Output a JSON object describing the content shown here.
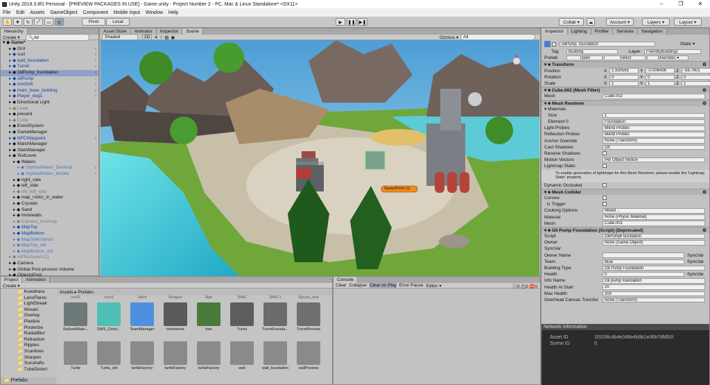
{
  "window": {
    "title": "Unity 2018.3.8f1 Personal - [PREVIEW PACKAGES IN USE] - Game.unity - Project Number 2 - PC, Mac & Linux Standalone* <DX11>",
    "min": "–",
    "max": "❐",
    "close": "✕"
  },
  "menu": [
    "File",
    "Edit",
    "Assets",
    "GameObject",
    "Component",
    "Mobile Input",
    "Window",
    "Help"
  ],
  "toolbar": {
    "pivot": "Pivot",
    "local": "Local",
    "collab": "Collab ▾",
    "account": "Account ▾",
    "layers": "Layers ▾",
    "layout": "Layout ▾"
  },
  "hierarchy": {
    "tab": "Hierarchy",
    "create": "Create ▾",
    "search": "All",
    "scene": "Game*",
    "rows": [
      {
        "t": "GUI",
        "i": 1,
        "c": "n",
        "a": 1
      },
      {
        "t": "wall",
        "i": 1,
        "c": "b",
        "a": 1
      },
      {
        "t": "wall_foundation",
        "i": 1,
        "c": "b",
        "a": 1
      },
      {
        "t": "Turret",
        "i": 1,
        "c": "b",
        "a": 1
      },
      {
        "t": "OilPump_foundation",
        "i": 1,
        "c": "s",
        "a": 1
      },
      {
        "t": "oilPump",
        "i": 1,
        "c": "b",
        "a": 1
      },
      {
        "t": "IronDrill",
        "i": 1,
        "c": "b",
        "a": 1
      },
      {
        "t": "main_base_building",
        "i": 1,
        "c": "b",
        "a": 1
      },
      {
        "t": "Player_dog1",
        "i": 1,
        "c": "b",
        "a": 1
      },
      {
        "t": "Directional Light",
        "i": 1,
        "c": "n"
      },
      {
        "t": "Level",
        "i": 1,
        "c": "g"
      },
      {
        "t": "present",
        "i": 1,
        "c": "n"
      },
      {
        "t": "Cube",
        "i": 1,
        "c": "g"
      },
      {
        "t": "EventSystem",
        "i": 1,
        "c": "n"
      },
      {
        "t": "GameManager",
        "i": 1,
        "c": "n"
      },
      {
        "t": "NPCWaypoint",
        "i": 1,
        "c": "b",
        "a": 1
      },
      {
        "t": "MatchManager",
        "i": 1,
        "c": "n"
      },
      {
        "t": "StatsManager",
        "i": 1,
        "c": "n"
      },
      {
        "t": "TestLevel",
        "i": 1,
        "c": "n"
      },
      {
        "t": "Waters",
        "i": 2,
        "c": "n"
      },
      {
        "t": "StylizedWater_Desktop",
        "i": 3,
        "c": "l",
        "a": 1
      },
      {
        "t": "StylizedWater_Mobile",
        "i": 3,
        "c": "l",
        "a": 1
      },
      {
        "t": "right_side",
        "i": 2,
        "c": "n"
      },
      {
        "t": "left_side",
        "i": 2,
        "c": "n"
      },
      {
        "t": "old_left_side",
        "i": 2,
        "c": "g"
      },
      {
        "t": "map_rocks_in_water",
        "i": 2,
        "c": "n"
      },
      {
        "t": "Crystals",
        "i": 2,
        "c": "n"
      },
      {
        "t": "Sand",
        "i": 2,
        "c": "n"
      },
      {
        "t": "Invisiwalls",
        "i": 2,
        "c": "n"
      },
      {
        "t": "Camera_minimap",
        "i": 2,
        "c": "g"
      },
      {
        "t": "MapTop",
        "i": 2,
        "c": "b"
      },
      {
        "t": "MapBottom",
        "i": 2,
        "c": "b"
      },
      {
        "t": "MapSideIslands",
        "i": 2,
        "c": "l"
      },
      {
        "t": "MapTop_old",
        "i": 2,
        "c": "l"
      },
      {
        "t": "MapBottom_old",
        "i": 2,
        "c": "l"
      },
      {
        "t": "oldTestLevel (1)",
        "i": 1,
        "c": "g"
      },
      {
        "t": "Camera",
        "i": 1,
        "c": "n"
      },
      {
        "t": "Global Post-process Volume",
        "i": 1,
        "c": "n"
      },
      {
        "t": "ObjectsPool",
        "i": 1,
        "c": "n"
      }
    ]
  },
  "sceneTabs": [
    "Asset Store",
    "Animator",
    "Inspector",
    "Scene"
  ],
  "sceneBar": {
    "shading": "Shaded",
    "mode": "2D",
    "gizmos": "Gizmos ▾",
    "search": "All"
  },
  "sceneLabel": "SpawnPoint (1)",
  "project": {
    "tabs": [
      "Project",
      "Animation"
    ],
    "create": "Create ▾",
    "tree": [
      "Kuwahara",
      "LensFlares",
      "LightStreak",
      "Mosaic",
      "Overlay",
      "Pixelize",
      "Posterize",
      "RadialBlur",
      "Refraction",
      "Ripples",
      "Scanlines",
      "Sharpen",
      "Sunshafts",
      "TubeDistort"
    ],
    "footer": "Prefabs",
    "breadcrumb": [
      "Assets",
      "Prefabs"
    ],
    "topLabels": [
      "rock2",
      "rock3",
      "Sand",
      "Shotgun",
      "Sign",
      "SMG",
      "SMG 1",
      "Spruce_tree"
    ],
    "items": [
      "StylizedWate...",
      "SWS_Circle...",
      "TeamManager",
      "tombstone",
      "tree",
      "Turret",
      "TurretFounda...",
      "TurretPreview"
    ],
    "row2": [
      "Turtle",
      "Turtle_old",
      "turtleFactory",
      "turtleFactory",
      "turtleFactory",
      "wall",
      "wall_foundation",
      "wallPreview"
    ]
  },
  "console": {
    "tab": "Console",
    "buttons": [
      "Clear",
      "Collapse",
      "Clear on Play",
      "Error Pause",
      "Editor ▾"
    ],
    "counts": [
      "0",
      "0",
      "0"
    ]
  },
  "inspector": {
    "tabs": [
      "Inspector",
      "Lighting",
      "Profiler",
      "Services",
      "Navigation"
    ],
    "name": "oilPump_foundation",
    "static": "Static ▾",
    "tag": "Building",
    "layer": "FriendlyBuildings",
    "prefabBtns": [
      "Open",
      "Select",
      "Overrides ▾"
    ],
    "transform": {
      "title": "Transform",
      "pos": [
        "1.930565",
        "-0.006436",
        "-58.7601"
      ],
      "rot": [
        "0",
        "0",
        "0"
      ],
      "scale": [
        "1",
        "1",
        "1"
      ]
    },
    "meshFilter": {
      "title": "Cube.002 (Mesh Filter)",
      "mesh": "Cube.002"
    },
    "renderer": {
      "title": "Mesh Renderer",
      "size": "1",
      "element0": "Foundation",
      "lightProbes": "Blend Probes",
      "reflection": "Blend Probes",
      "anchor": "None (Transform)",
      "castShadows": "On",
      "motion": "Per Object Motion",
      "info": "To enable generation of lightmaps for this Mesh Renderer, please enable the 'Lightmap Static' property."
    },
    "collider": {
      "title": "Mesh Collider",
      "cooking": "Mixed ...",
      "material": "None (Physic Material)",
      "mesh": "Cube.001"
    },
    "script": {
      "title": "Oil Pump Foundation (Script) (Deprecated)",
      "script": "OilPumpFoundation",
      "owner": "None (Game Object)",
      "team": "Blue",
      "buildingType": "Oil Pump Foundation",
      "health": "0",
      "infoName": "Oil pump foundation",
      "healthStart": "20",
      "maxHealth": "200",
      "canvas": "None (Transform)"
    },
    "network": {
      "title": "Network Information",
      "assetId": "1f3156c4b4e346e4b9b1e36b7dfd50l",
      "sceneId": "0"
    }
  }
}
